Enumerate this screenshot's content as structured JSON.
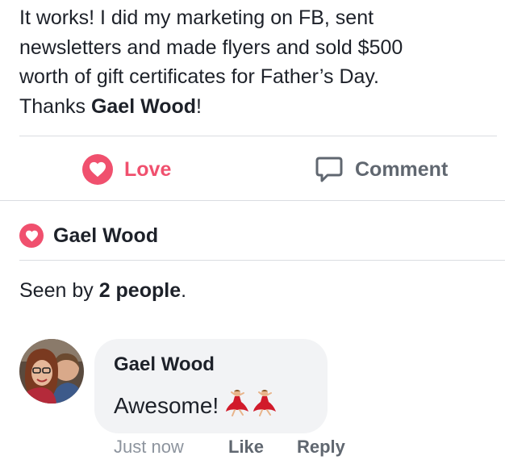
{
  "post": {
    "line1": "It works! I did my marketing on FB, sent",
    "line2": "newsletters and made flyers and sold $500",
    "line3": "worth of  gift certificates for Father’s Day.",
    "line4_prefix": "Thanks ",
    "line4_name": "Gael Wood",
    "line4_suffix": "!"
  },
  "actions": {
    "love_label": "Love",
    "comment_label": "Comment"
  },
  "reactions": {
    "reactor_name": "Gael Wood",
    "icon": "heart-icon"
  },
  "seen": {
    "prefix": "Seen by ",
    "count_text": "2 people",
    "suffix": "."
  },
  "comment": {
    "author": "Gael Wood",
    "text": "Awesome!",
    "emoji": [
      "dancer-icon",
      "dancer-icon"
    ],
    "time": "Just now",
    "like_label": "Like",
    "reply_label": "Reply"
  },
  "colors": {
    "love": "#f0506e",
    "text": "#1d2129",
    "secondary": "#606770",
    "bubble": "#f2f3f5",
    "divider": "#dadde1"
  }
}
